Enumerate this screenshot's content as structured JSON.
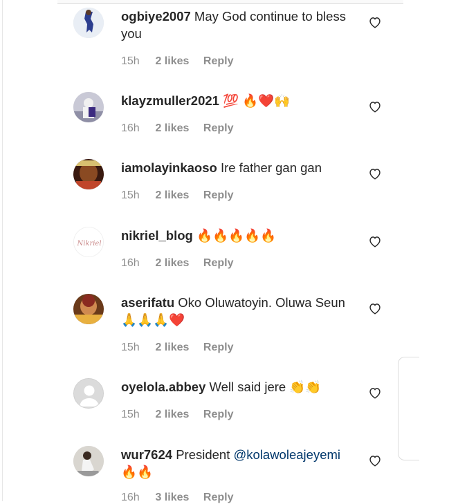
{
  "comments": [
    {
      "username": "ogbiye2007",
      "text": "May God continue to bless you",
      "mention": "",
      "emoji": "",
      "time": "15h",
      "likes": "2 likes",
      "reply": "Reply"
    },
    {
      "username": "klayzmuller2021",
      "text": "",
      "mention": "",
      "emoji": "💯 🔥❤️🙌",
      "time": "16h",
      "likes": "2 likes",
      "reply": "Reply"
    },
    {
      "username": "iamolayinkaoso",
      "text": "Ire father gan gan",
      "mention": "",
      "emoji": "",
      "time": "15h",
      "likes": "2 likes",
      "reply": "Reply"
    },
    {
      "username": "nikriel_blog",
      "text": "",
      "mention": "",
      "emoji": "🔥🔥🔥🔥🔥",
      "time": "16h",
      "likes": "2 likes",
      "reply": "Reply"
    },
    {
      "username": "aserifatu",
      "text": "Oko Oluwatoyin. Oluwa Seun",
      "mention": "",
      "emoji": "🙏🙏🙏❤️",
      "time": "15h",
      "likes": "2 likes",
      "reply": "Reply"
    },
    {
      "username": "oyelola.abbey",
      "text": "Well said jere",
      "mention": "",
      "emoji": "👏👏",
      "time": "15h",
      "likes": "2 likes",
      "reply": "Reply"
    },
    {
      "username": "wur7624",
      "text": "President",
      "mention": "@kolawoleajeyemi",
      "emoji": "🔥🔥",
      "time": "16h",
      "likes": "3 likes",
      "reply": "Reply"
    }
  ],
  "avatar_logo_text": "Nikriel",
  "colors": {
    "meta_gray": "#8e8e8e",
    "text": "#262626",
    "mention": "#00376b"
  }
}
